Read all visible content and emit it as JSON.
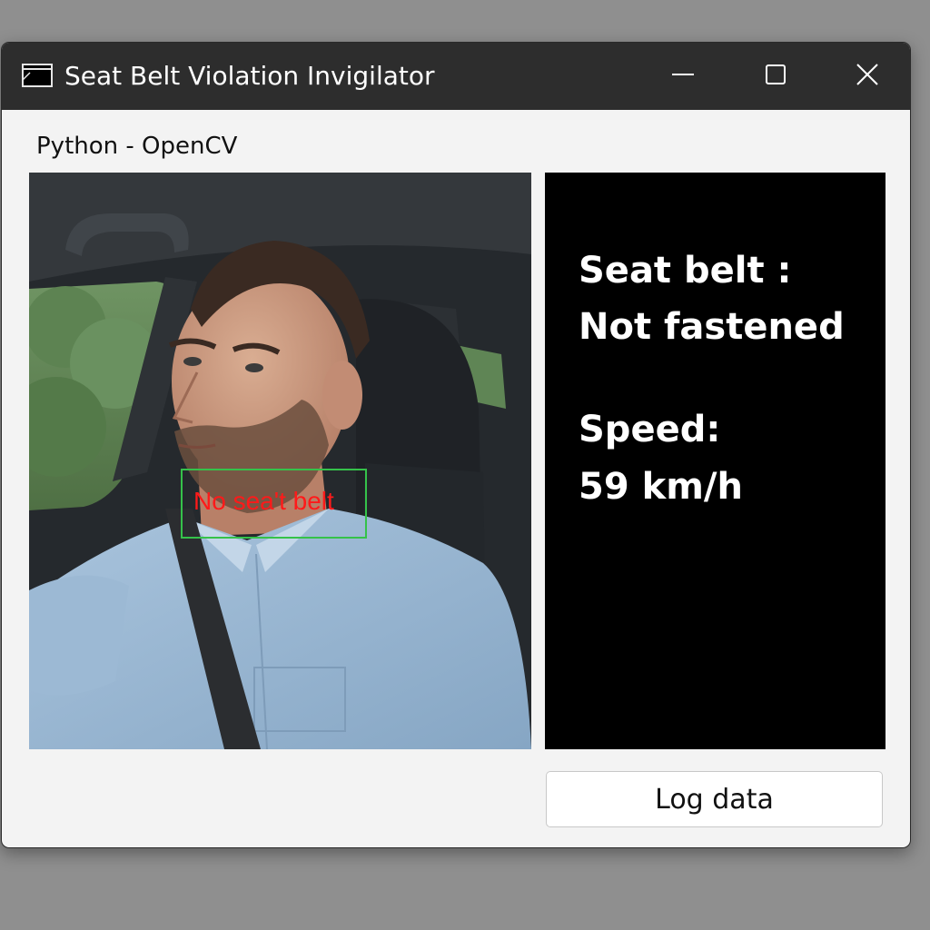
{
  "window": {
    "title": "Seat Belt Violation Invigilator",
    "icon": "window-app-icon",
    "controls": {
      "minimize_icon": "minimize-icon",
      "maximize_icon": "maximize-icon",
      "close_icon": "close-icon"
    }
  },
  "subtitle": "Python - OpenCV",
  "camera_feed": {
    "detection_label": "No sea't belt",
    "detection_box_color": "#35c24a",
    "detection_label_color": "#ff1a1a"
  },
  "status_panel": {
    "seatbelt_label": "Seat belt :",
    "seatbelt_value": "Not fastened",
    "speed_label": "Speed:",
    "speed_value": "59 km/h",
    "background_color": "#000000",
    "text_color": "#ffffff"
  },
  "actions": {
    "log_button_label": "Log data"
  },
  "colors": {
    "titlebar": "#2d2d2d",
    "window_background": "#f3f3f3"
  }
}
